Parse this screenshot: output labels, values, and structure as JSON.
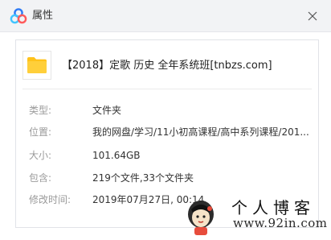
{
  "window": {
    "title": "属性",
    "app_icon": "baidu-netdisk-cloud-icon",
    "close_icon": "close-icon"
  },
  "item": {
    "icon": "folder-icon",
    "name": "【2018】定歌 历史 全年系统班[tnbzs.com]"
  },
  "properties": [
    {
      "label": "类型:",
      "value": "文件夹"
    },
    {
      "label": "位置:",
      "value": "我的网盘/学习/11小初高课程/高中系列课程/201..."
    },
    {
      "label": "大小:",
      "value": "101.64GB"
    },
    {
      "label": "包含:",
      "value": "219个文件,33个文件夹"
    },
    {
      "label": "修改时间:",
      "value": "2019年07月27日, 00:14"
    }
  ],
  "watermark": {
    "title": "个人博客",
    "url": "www.92in.com"
  },
  "colors": {
    "titlebar_bg": "#f2f3f5",
    "folder_yellow": "#ffc21a",
    "label_gray": "#9a9a9a"
  }
}
